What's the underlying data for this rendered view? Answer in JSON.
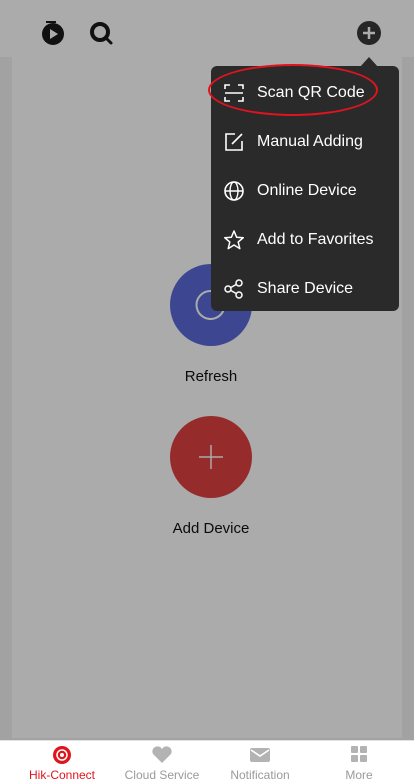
{
  "header": {
    "left_icons": [
      "play-record-icon",
      "search-icon"
    ],
    "right_icon": "plus-icon"
  },
  "main": {
    "refresh_label": "Refresh",
    "add_device_label": "Add Device"
  },
  "menu": {
    "items": [
      {
        "label": "Scan QR Code",
        "icon": "scan-icon"
      },
      {
        "label": "Manual Adding",
        "icon": "edit-icon"
      },
      {
        "label": "Online Device",
        "icon": "globe-icon"
      },
      {
        "label": "Add to Favorites",
        "icon": "star-icon"
      },
      {
        "label": "Share Device",
        "icon": "share-icon"
      }
    ]
  },
  "tabs": [
    {
      "label": "Hik-Connect",
      "icon": "hik-connect-icon",
      "active": true
    },
    {
      "label": "Cloud Service",
      "icon": "heart-icon",
      "active": false
    },
    {
      "label": "Notification",
      "icon": "envelope-icon",
      "active": false
    },
    {
      "label": "More",
      "icon": "grid-icon",
      "active": false
    }
  ],
  "colors": {
    "accent": "#e0141e",
    "refresh_button": "#5b6bd9",
    "add_button": "#e04141",
    "menu_bg": "#2a2a2a"
  }
}
